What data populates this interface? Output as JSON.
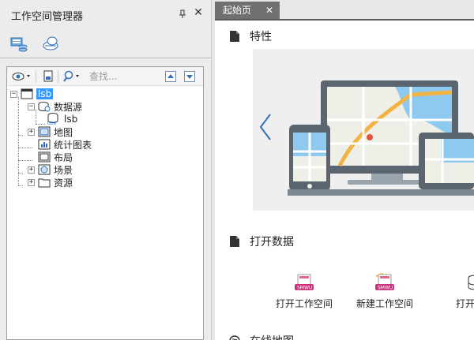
{
  "workspace_panel": {
    "title": "工作空间管理器",
    "search_placeholder": "查找..."
  },
  "tree": {
    "root": "lsb",
    "datasources": "数据源",
    "datasource_lsb": "lsb",
    "maps": "地图",
    "charts": "统计图表",
    "layouts": "布局",
    "scenes": "场景",
    "resources": "资源"
  },
  "start_page": {
    "tab_label": "起始页",
    "features_title": "特性",
    "open_data_title": "打开数据",
    "online_map_title": "在线地图",
    "actions": {
      "open_workspace": "打开工作空间",
      "new_workspace": "新建工作空间",
      "open_data": "打开数"
    }
  },
  "colors": {
    "selection": "#3399ff",
    "tab_bg": "#707070",
    "arrow_blue": "#2f6fbf",
    "map_water": "#8ec9f0",
    "map_road": "#f3b244"
  },
  "icons": {
    "panel_tab_1": "workspace-tree-icon",
    "panel_tab_2": "scene-cloud-icon"
  }
}
